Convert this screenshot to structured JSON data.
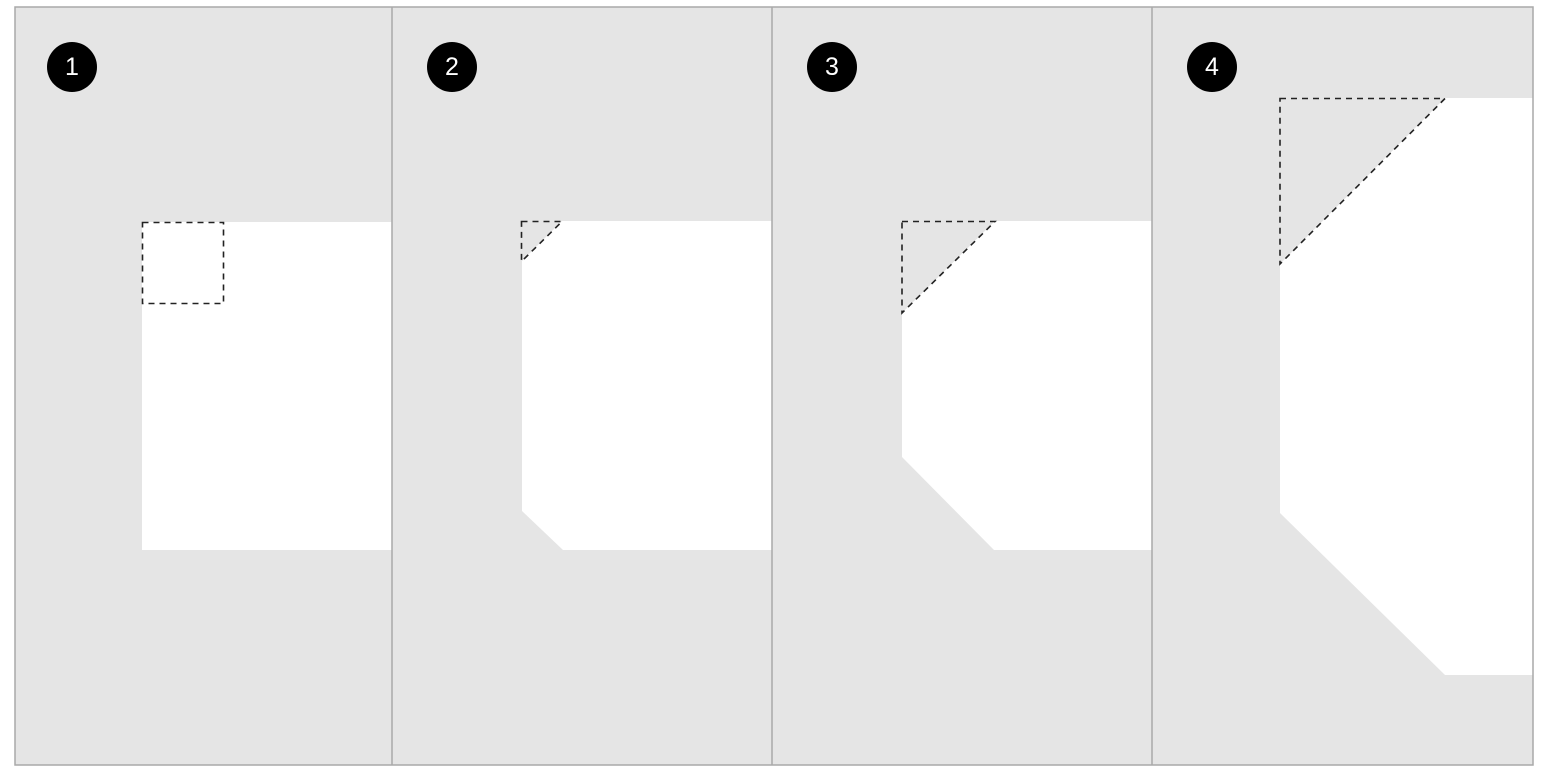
{
  "diagram": {
    "colors": {
      "panel_background": "#e5e5e5",
      "panel_border": "#a9a9a9",
      "shape_fill": "#ffffff",
      "badge_fill": "#000000",
      "badge_text": "#ffffff",
      "dash_stroke": "#222222"
    },
    "panels": [
      {
        "step": "1",
        "corner_treatment": "dashed-square"
      },
      {
        "step": "2",
        "corner_treatment": "small-dashed-triangle"
      },
      {
        "step": "3",
        "corner_treatment": "medium-dashed-triangle"
      },
      {
        "step": "4",
        "corner_treatment": "large-dashed-triangle"
      }
    ]
  }
}
